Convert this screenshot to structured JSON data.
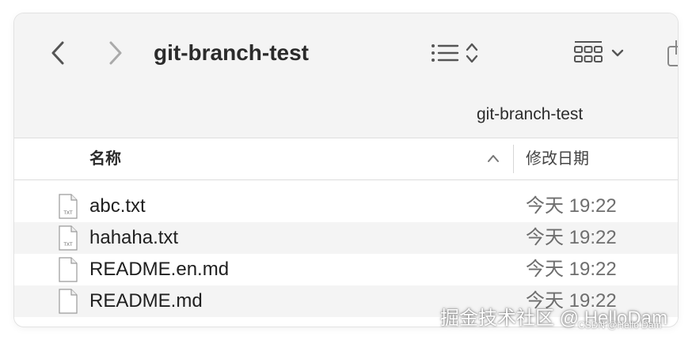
{
  "window": {
    "title": "git-branch-test",
    "path_label": "git-branch-test"
  },
  "toolbar": {
    "back_icon": "chevron-left-icon",
    "forward_icon": "chevron-right-icon",
    "list_view_icon": "list-view-icon",
    "sort_order_icon": "updown-chevron-icon",
    "grid_view_icon": "grid-view-icon",
    "grid_menu_icon": "chevron-down-icon",
    "share_icon": "share-icon"
  },
  "columns": {
    "name": "名称",
    "date": "修改日期",
    "sort_icon": "chevron-up-icon"
  },
  "files": [
    {
      "name": "abc.txt",
      "date": "今天 19:22",
      "icon": "txt-file-icon"
    },
    {
      "name": "hahaha.txt",
      "date": "今天 19:22",
      "icon": "txt-file-icon"
    },
    {
      "name": "README.en.md",
      "date": "今天 19:22",
      "icon": "document-icon"
    },
    {
      "name": "README.md",
      "date": "今天 19:22",
      "icon": "document-icon"
    }
  ],
  "watermark": {
    "main": "掘金技术社区 @ HelloDam",
    "small": "CSDN @Hello Dam"
  }
}
